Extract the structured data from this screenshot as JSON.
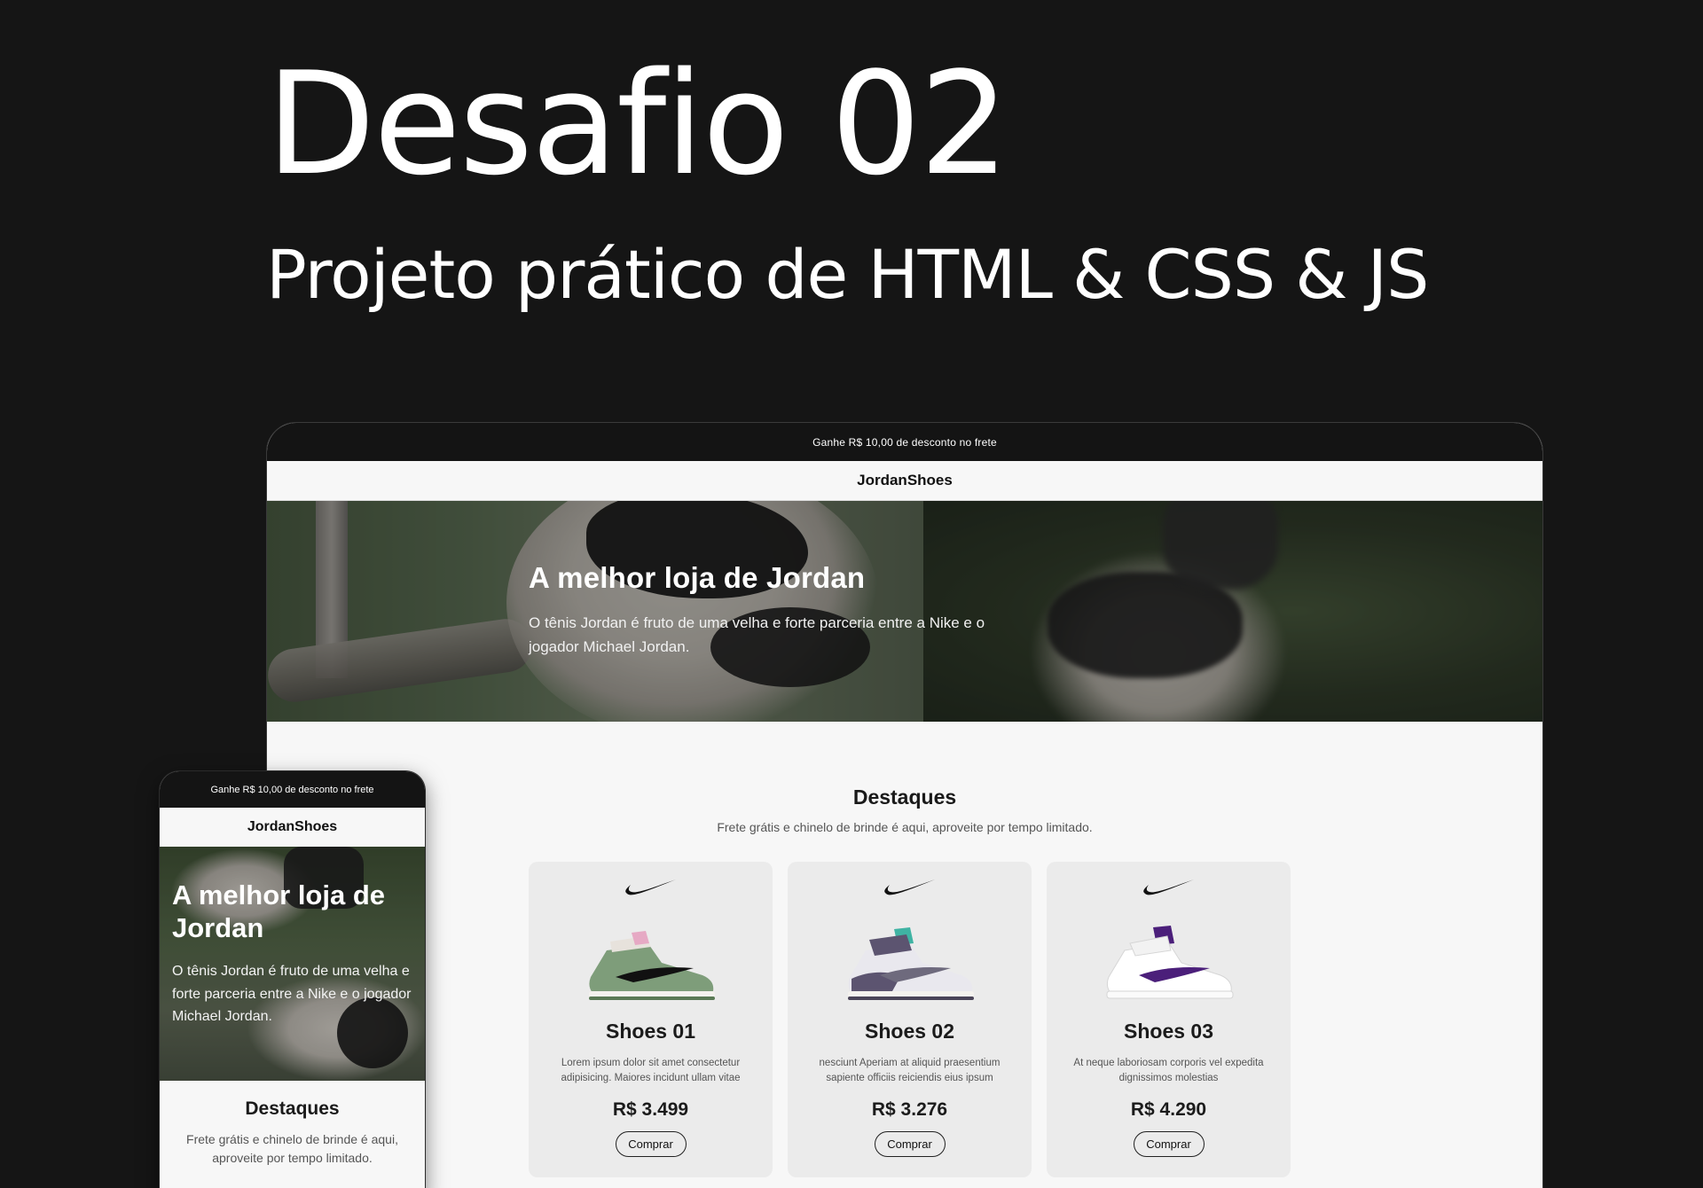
{
  "header": {
    "title": "Desafio 02",
    "subtitle": "Projeto prático de HTML & CSS & JS"
  },
  "site": {
    "promo": "Ganhe R$ 10,00 de desconto no frete",
    "brand": "JordanShoes",
    "banner": {
      "title": "A melhor loja de Jordan",
      "text": "O tênis Jordan é fruto de uma velha e forte parceria entre a Nike e o jogador Michael Jordan."
    },
    "featured": {
      "title": "Destaques",
      "text": "Frete grátis e chinelo de brinde é aqui, aproveite por tempo limitado."
    },
    "products": [
      {
        "name": "Shoes 01",
        "description": "Lorem ipsum dolor sit amet consectetur adipisicing. Maiores incidunt ullam vitae",
        "price": "R$ 3.499",
        "button": "Comprar",
        "colors": {
          "upper": "#7e9d7a",
          "accent": "#e6a9c4",
          "swoosh": "#111111"
        }
      },
      {
        "name": "Shoes 02",
        "description": "nesciunt Aperiam at aliquid praesentium sapiente officiis reiciendis eius ipsum",
        "price": "R$ 3.276",
        "button": "Comprar",
        "colors": {
          "upper": "#5c5470",
          "accent": "#3fb3a3",
          "swoosh": "#6e6a7d"
        }
      },
      {
        "name": "Shoes 03",
        "description": "At neque laboriosam corporis vel expedita dignissimos molestias",
        "price": "R$ 4.290",
        "button": "Comprar",
        "colors": {
          "upper": "#ffffff",
          "accent": "#4b1f7a",
          "swoosh": "#4b1f7a"
        }
      }
    ]
  },
  "icons": {
    "brand_logo": "nike-swoosh-icon"
  }
}
